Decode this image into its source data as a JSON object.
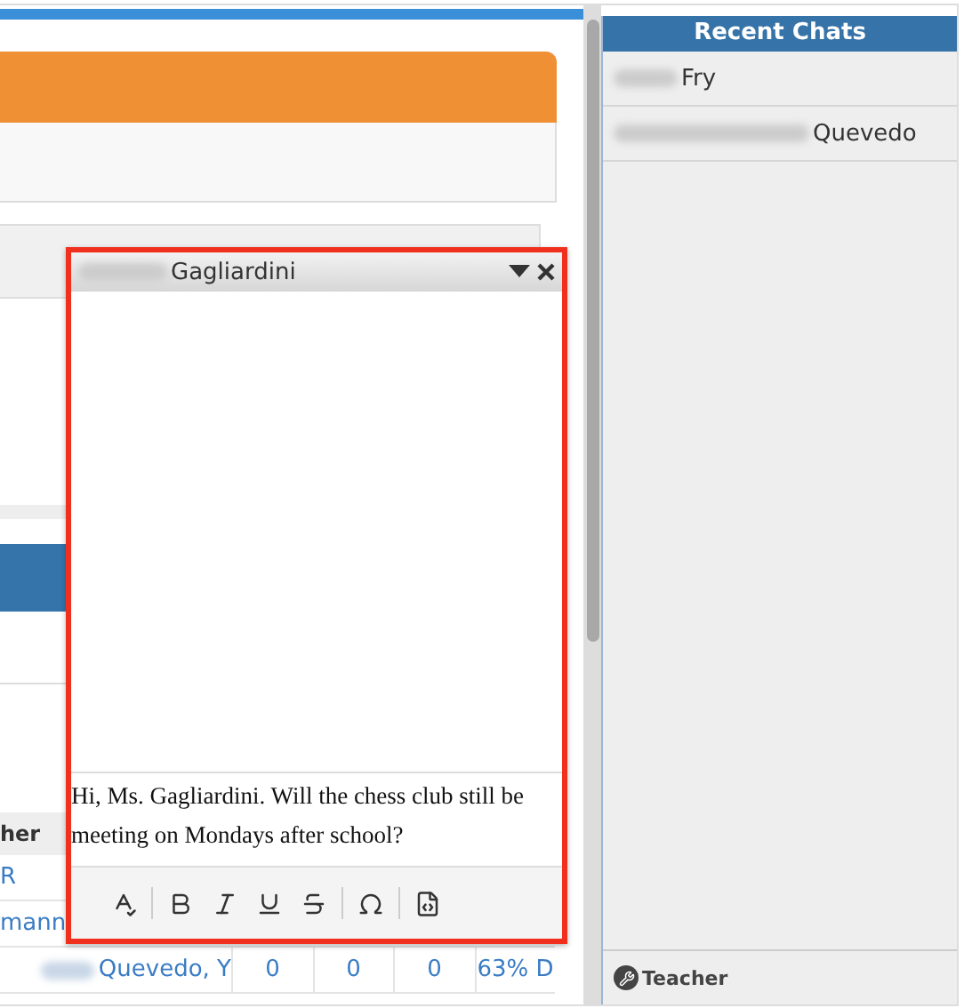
{
  "background": {
    "table": {
      "header": "her",
      "rows": [
        {
          "name": "R",
          "cells": []
        },
        {
          "name": "mann",
          "cells": []
        },
        {
          "name": "Quevedo, Y",
          "cells": [
            "0",
            "0",
            "0",
            "63% D"
          ]
        }
      ]
    }
  },
  "chat_window": {
    "title": "Gagliardini",
    "message": "Hi, Ms. Gagliardini. Will the chess club still be meeting on Mondays after school?"
  },
  "sidebar": {
    "title": "Recent Chats",
    "chats": [
      {
        "name": "Fry"
      },
      {
        "name": "Quevedo"
      }
    ],
    "footer": "Teacher"
  }
}
